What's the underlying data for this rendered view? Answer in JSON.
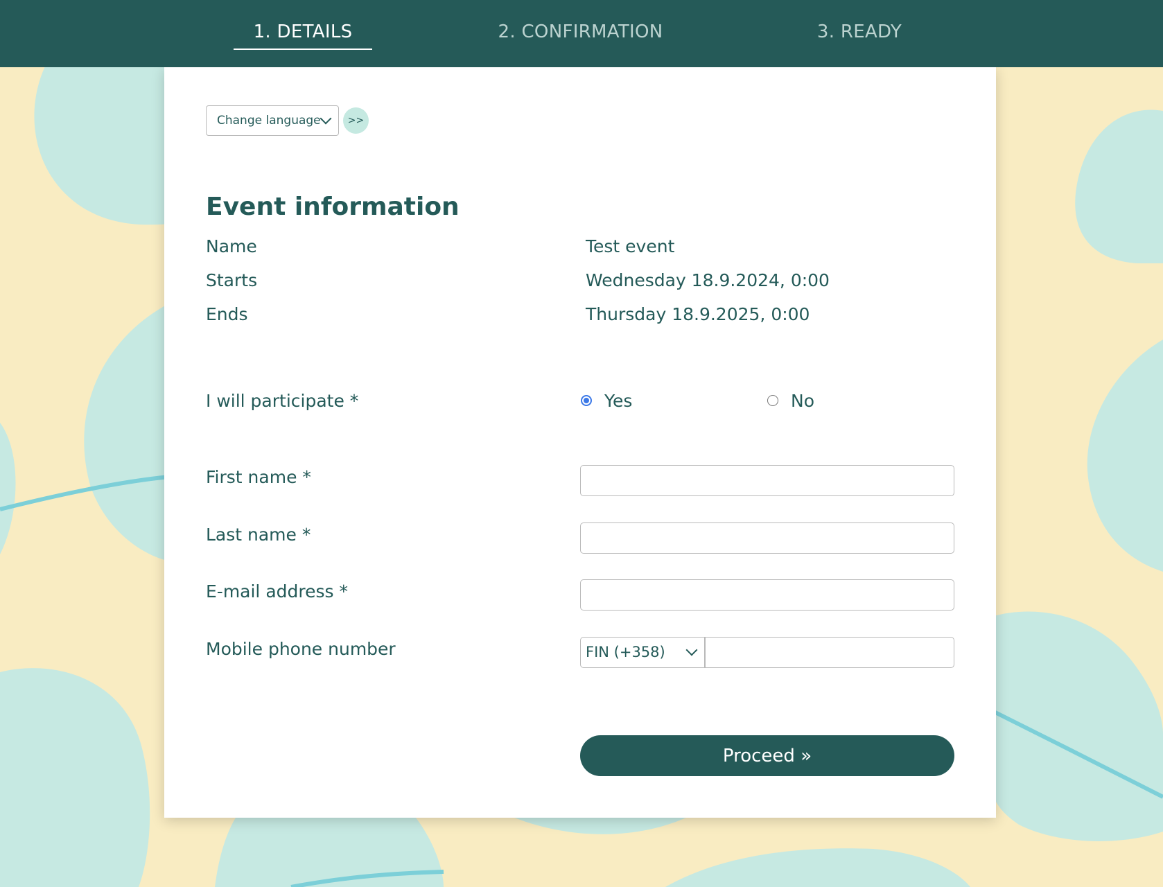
{
  "steps": [
    {
      "label": "1. DETAILS",
      "active": true
    },
    {
      "label": "2. CONFIRMATION",
      "active": false
    },
    {
      "label": "3. READY",
      "active": false
    }
  ],
  "language": {
    "select_label": "Change language",
    "go_label": ">>"
  },
  "event": {
    "title": "Event information",
    "rows": [
      {
        "label": "Name",
        "value": "Test event"
      },
      {
        "label": "Starts",
        "value": "Wednesday 18.9.2024, 0:00"
      },
      {
        "label": "Ends",
        "value": "Thursday 18.9.2025, 0:00"
      }
    ]
  },
  "form": {
    "participate": {
      "label": "I will participate *",
      "options": [
        {
          "label": "Yes",
          "checked": true
        },
        {
          "label": "No",
          "checked": false
        }
      ]
    },
    "first_name": {
      "label": "First name *",
      "value": ""
    },
    "last_name": {
      "label": "Last name *",
      "value": ""
    },
    "email": {
      "label": "E-mail address *",
      "value": ""
    },
    "phone": {
      "label": "Mobile phone number",
      "country_code": "FIN (+358)",
      "value": ""
    },
    "submit_label": "Proceed »"
  },
  "colors": {
    "header_bg": "#255a58",
    "page_bg": "#f9ecc2",
    "blob": "#c6e9e2",
    "line": "#7ccfd8",
    "text": "#245a58",
    "radio_accent": "#3b78e7"
  }
}
